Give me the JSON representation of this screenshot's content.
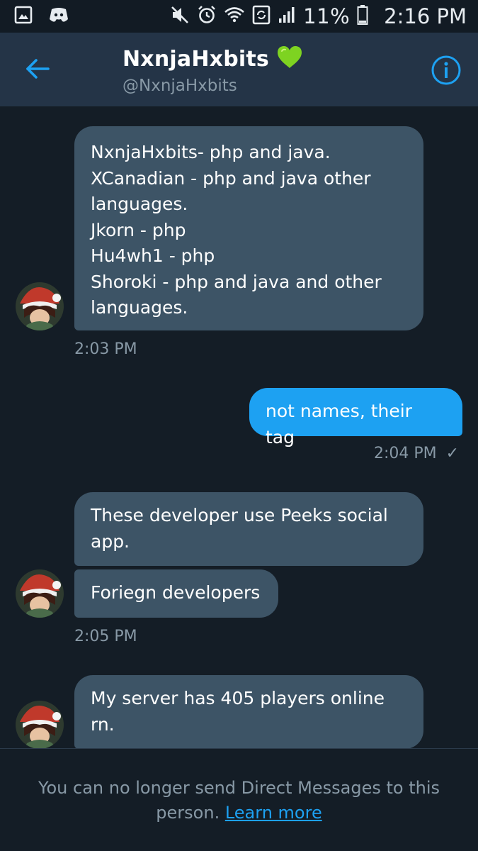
{
  "status_bar": {
    "battery_percent": "11%",
    "time": "2:16 PM",
    "icons": [
      "gallery-icon",
      "discord-icon",
      "mute-icon",
      "alarm-icon",
      "wifi-icon",
      "sync-icon",
      "signal-icon",
      "battery-icon"
    ]
  },
  "header": {
    "title": "NxnjaHxbits",
    "title_emoji": "💚",
    "handle": "@NxnjaHxbits"
  },
  "messages": [
    {
      "direction": "incoming",
      "text": "NxnjaHxbits- php and java.\nXCanadian - php and java other\nlanguages.\nJkorn - php\nHu4wh1 - php\nShoroki - php and java and other\nlanguages."
    },
    {
      "timestamp": "2:03 PM"
    },
    {
      "direction": "outgoing",
      "text": "not names, their tag"
    },
    {
      "timestamp": "2:04 PM",
      "read_mark": "✓"
    },
    {
      "direction": "incoming",
      "text": "These developer use Peeks social\napp."
    },
    {
      "direction": "incoming",
      "text": "Foriegn developers"
    },
    {
      "timestamp": "2:05 PM"
    },
    {
      "direction": "incoming",
      "text": "My server has 405 players online\nrn."
    }
  ],
  "footer": {
    "notice": "You can no longer send Direct Messages to this person. ",
    "link_label": "Learn more"
  },
  "colors": {
    "background": "#141d26",
    "header": "#243447",
    "incoming_bubble": "#3d5466",
    "outgoing_bubble": "#1da1f2",
    "accent": "#1da1f2",
    "muted_text": "#8899a6"
  }
}
